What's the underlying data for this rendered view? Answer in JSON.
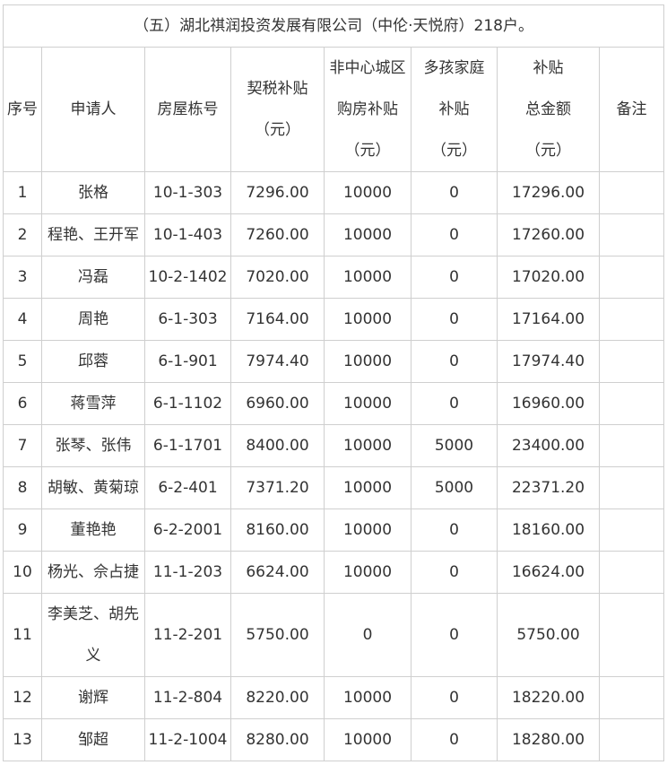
{
  "table": {
    "title": "（五）湖北祺润投资发展有限公司（中伦·天悦府）218户。",
    "headers": [
      [
        "序号"
      ],
      [
        "申请人"
      ],
      [
        "房屋栋号"
      ],
      [
        "契税补贴",
        "（元）"
      ],
      [
        "非中心城区",
        "购房补贴",
        "（元）"
      ],
      [
        "多孩家庭",
        "补贴",
        "（元）"
      ],
      [
        "补贴",
        "总金额",
        "（元）"
      ],
      [
        "备注"
      ]
    ],
    "rows": [
      {
        "no": "1",
        "applicant": [
          "张格"
        ],
        "unit": "10-1-303",
        "deed_tax": "7296.00",
        "non_center": "10000",
        "multi_child": "0",
        "total": "17296.00",
        "note": ""
      },
      {
        "no": "2",
        "applicant": [
          "程艳、王开军"
        ],
        "unit": "10-1-403",
        "deed_tax": "7260.00",
        "non_center": "10000",
        "multi_child": "0",
        "total": "17260.00",
        "note": ""
      },
      {
        "no": "3",
        "applicant": [
          "冯磊"
        ],
        "unit": "10-2-1402",
        "deed_tax": "7020.00",
        "non_center": "10000",
        "multi_child": "0",
        "total": "17020.00",
        "note": ""
      },
      {
        "no": "4",
        "applicant": [
          "周艳"
        ],
        "unit": "6-1-303",
        "deed_tax": "7164.00",
        "non_center": "10000",
        "multi_child": "0",
        "total": "17164.00",
        "note": ""
      },
      {
        "no": "5",
        "applicant": [
          "邱蓉"
        ],
        "unit": "6-1-901",
        "deed_tax": "7974.40",
        "non_center": "10000",
        "multi_child": "0",
        "total": "17974.40",
        "note": ""
      },
      {
        "no": "6",
        "applicant": [
          "蒋雪萍"
        ],
        "unit": "6-1-1102",
        "deed_tax": "6960.00",
        "non_center": "10000",
        "multi_child": "0",
        "total": "16960.00",
        "note": ""
      },
      {
        "no": "7",
        "applicant": [
          "张琴、张伟"
        ],
        "unit": "6-1-1701",
        "deed_tax": "8400.00",
        "non_center": "10000",
        "multi_child": "5000",
        "total": "23400.00",
        "note": ""
      },
      {
        "no": "8",
        "applicant": [
          "胡敏、黄菊琼"
        ],
        "unit": "6-2-401",
        "deed_tax": "7371.20",
        "non_center": "10000",
        "multi_child": "5000",
        "total": "22371.20",
        "note": ""
      },
      {
        "no": "9",
        "applicant": [
          "董艳艳"
        ],
        "unit": "6-2-2001",
        "deed_tax": "8160.00",
        "non_center": "10000",
        "multi_child": "0",
        "total": "18160.00",
        "note": ""
      },
      {
        "no": "10",
        "applicant": [
          "杨光、佘占捷"
        ],
        "unit": "11-1-203",
        "deed_tax": "6624.00",
        "non_center": "10000",
        "multi_child": "0",
        "total": "16624.00",
        "note": ""
      },
      {
        "no": "11",
        "applicant": [
          "李美芝、胡先",
          "义"
        ],
        "unit": "11-2-201",
        "deed_tax": "5750.00",
        "non_center": "0",
        "multi_child": "0",
        "total": "5750.00",
        "note": ""
      },
      {
        "no": "12",
        "applicant": [
          "谢辉"
        ],
        "unit": "11-2-804",
        "deed_tax": "8220.00",
        "non_center": "10000",
        "multi_child": "0",
        "total": "18220.00",
        "note": ""
      },
      {
        "no": "13",
        "applicant": [
          "邹超"
        ],
        "unit": "11-2-1004",
        "deed_tax": "8280.00",
        "non_center": "10000",
        "multi_child": "0",
        "total": "18280.00",
        "note": ""
      }
    ]
  }
}
